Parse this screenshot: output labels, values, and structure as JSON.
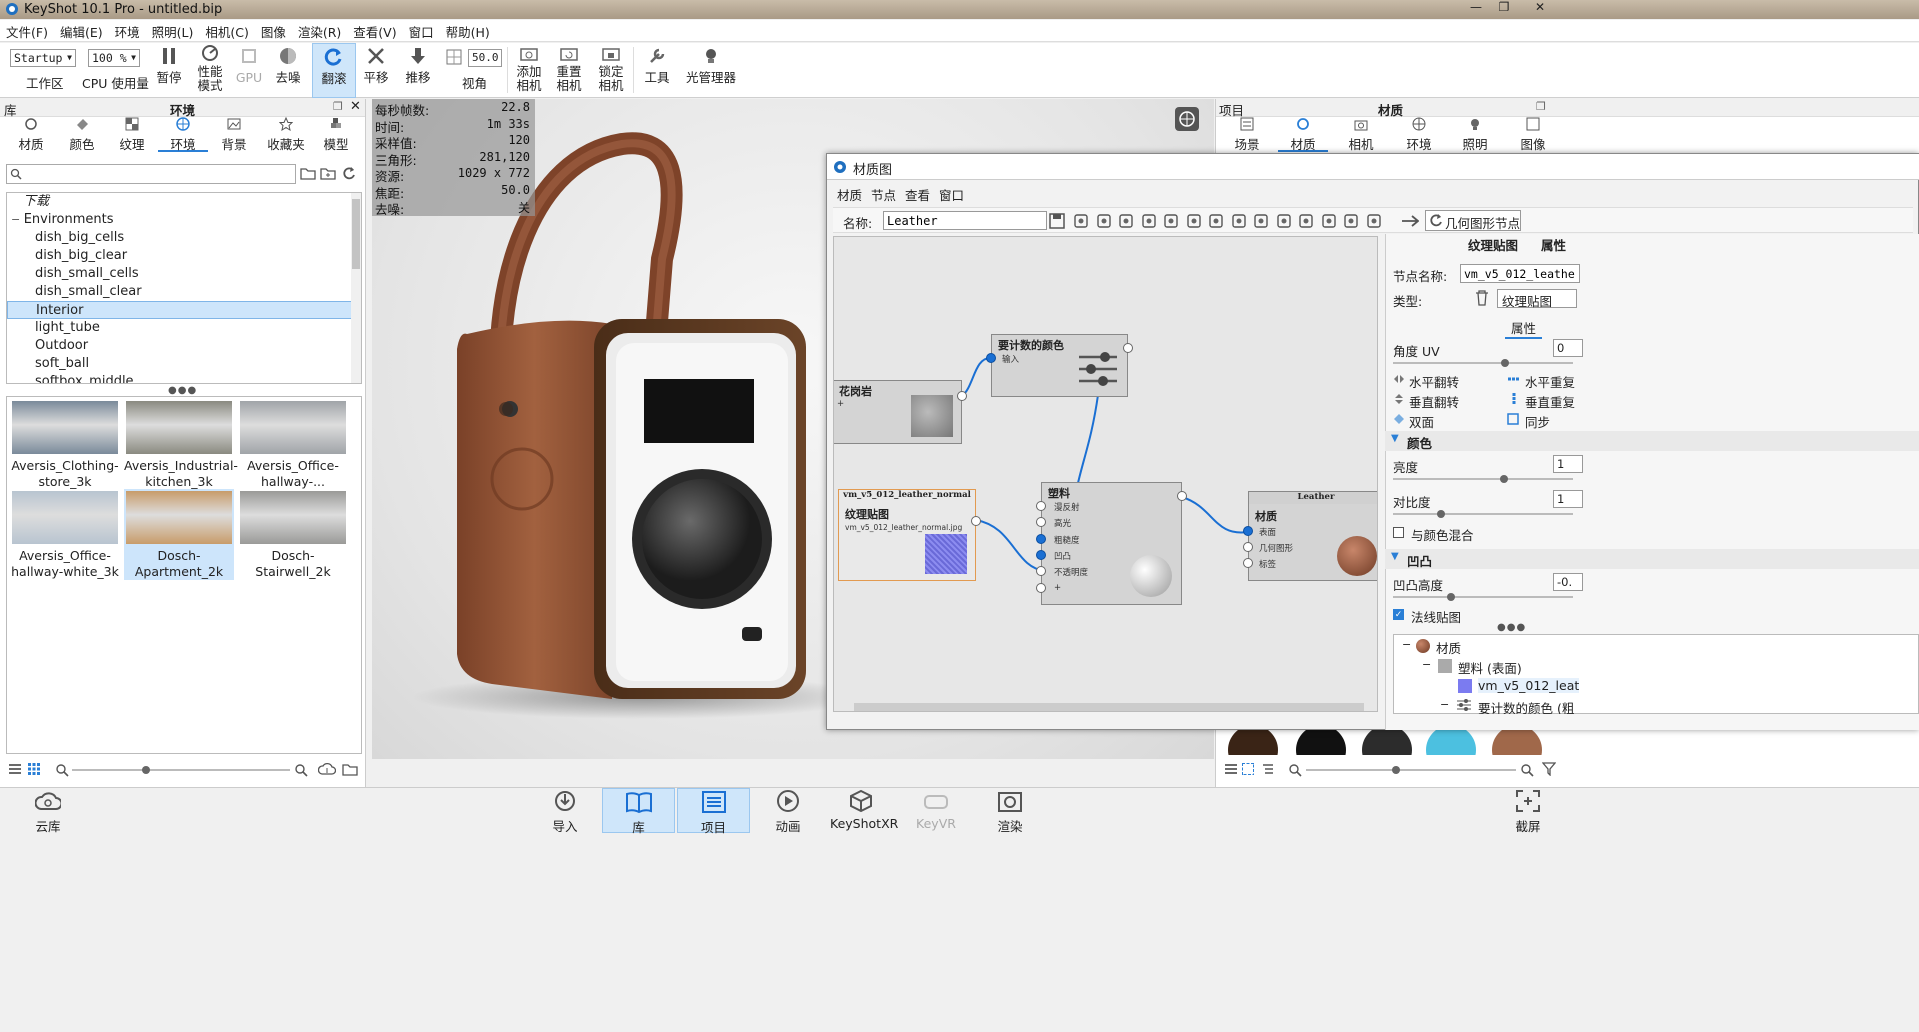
{
  "window": {
    "title": "KeyShot 10.1 Pro - untitled.bip",
    "minimize": "—",
    "restore": "❐",
    "close": "✕"
  },
  "menu": [
    "文件(F)",
    "编辑(E)",
    "环境",
    "照明(L)",
    "相机(C)",
    "图像",
    "渲染(R)",
    "查看(V)",
    "窗口",
    "帮助(H)"
  ],
  "toolbar": {
    "workspace_value": "Startup",
    "workspace_label": "工作区",
    "cpu_value": "100 %",
    "cpu_label": "CPU 使用量",
    "pause": "暂停",
    "perf_mode_1": "性能",
    "perf_mode_2": "模式",
    "gpu": "GPU",
    "denoise": "去噪",
    "tumble": "翻滚",
    "pan": "平移",
    "dolly": "推移",
    "fov_value": "50.0",
    "fov_label": "视角",
    "add_camera_1": "添加",
    "add_camera_2": "相机",
    "reset_camera_1": "重置",
    "reset_camera_2": "相机",
    "lock_camera_1": "锁定",
    "lock_camera_2": "相机",
    "tools": "工具",
    "light_manager": "光管理器"
  },
  "library": {
    "header_left": "库",
    "header_title": "环境",
    "tabs": [
      "材质",
      "颜色",
      "纹理",
      "环境",
      "背景",
      "收藏夹",
      "模型"
    ],
    "active_tab": 3,
    "search_placeholder": "",
    "tree": {
      "downloads": "下载",
      "root": "Environments",
      "items": [
        "dish_big_cells",
        "dish_big_clear",
        "dish_small_cells",
        "dish_small_clear",
        "Interior",
        "light_tube",
        "Outdoor",
        "soft_ball",
        "softbox_middle"
      ],
      "selected": 4
    },
    "thumbnails": [
      [
        "Aversis_Clothing-",
        "store_3k"
      ],
      [
        "Aversis_Industrial-",
        "kitchen_3k"
      ],
      [
        "Aversis_Office-",
        "hallway-..."
      ],
      [
        "Aversis_Office-",
        "hallway-white_3k"
      ],
      [
        "Dosch-",
        "Apartment_2k"
      ],
      [
        "Dosch-",
        "Stairwell_2k"
      ]
    ],
    "selected_thumb": 4
  },
  "hud": {
    "rows": [
      [
        "每秒帧数:",
        "22.8"
      ],
      [
        "时间:",
        "1m 33s"
      ],
      [
        "采样值:",
        "120"
      ],
      [
        "三角形:",
        "281,120"
      ],
      [
        "资源:",
        "1029 x 772"
      ],
      [
        "焦距:",
        "50.0"
      ],
      [
        "去噪:",
        "关"
      ]
    ]
  },
  "project": {
    "header_left": "项目",
    "header_title": "材质",
    "tabs": [
      "场景",
      "材质",
      "相机",
      "环境",
      "照明",
      "图像"
    ],
    "active_tab": 1
  },
  "material_graph": {
    "title": "材质图",
    "menu": [
      "材质",
      "节点",
      "查看",
      "窗口"
    ],
    "name_label": "名称:",
    "name_value": "Leather",
    "geometry_node_button": "几何图形节点",
    "nodes": {
      "granite": {
        "title": "花岗岩",
        "sub": "+"
      },
      "color_adjust": {
        "title": "要计数的颜色",
        "input": "输入"
      },
      "texture": {
        "header": "vm_v5_012_leather_normal",
        "title": "纹理贴图",
        "file": "vm_v5_012_leather_normal.jpg"
      },
      "plastic": {
        "title": "塑料",
        "ports": [
          "漫反射",
          "高光",
          "粗糙度",
          "凹凸",
          "不透明度",
          "+"
        ]
      },
      "material": {
        "header": "Leather",
        "title": "材质",
        "ports": [
          "表面",
          "几何图形",
          "标签"
        ]
      }
    }
  },
  "properties": {
    "header_a": "纹理贴图",
    "header_b": "属性",
    "node_name_label": "节点名称:",
    "node_name_value": "vm_v5_012_leather",
    "type_label": "类型:",
    "type_value": "纹理贴图",
    "tab": "属性",
    "angle_label": "角度 UV",
    "angle_value": "0",
    "flip_h": "水平翻转",
    "repeat_h": "水平重复",
    "flip_v": "垂直翻转",
    "repeat_v": "垂直重复",
    "double_side": "双面",
    "sync": "同步",
    "color_section": "颜色",
    "brightness_label": "亮度",
    "brightness_value": "1",
    "contrast_label": "对比度",
    "contrast_value": "1",
    "blend_color": "与颜色混合",
    "bump_section": "凹凸",
    "bump_height_label": "凹凸高度",
    "bump_height_value": "-0.",
    "normal_map": "法线贴图",
    "tree": [
      "材质",
      "塑料 (表面)",
      "vm_v5_012_leat",
      "要计数的颜色 (粗"
    ]
  },
  "bottom": {
    "cloud": "云库",
    "import": "导入",
    "library": "库",
    "project": "项目",
    "animation": "动画",
    "keyshotxr": "KeyShotXR",
    "keyvr": "KeyVR",
    "render": "渲染",
    "screenshot": "截屏"
  },
  "colors": {
    "accent": "#2a7fd6",
    "selection": "#cde5fb",
    "leather": "#9a5a3c",
    "wood": "#5a3a22"
  }
}
